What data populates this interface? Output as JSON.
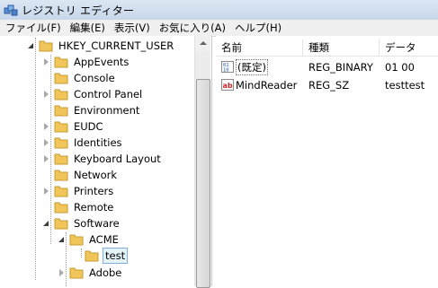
{
  "window": {
    "title": "レジストリ エディター"
  },
  "menu": [
    "ファイル(F)",
    "編集(E)",
    "表示(V)",
    "お気に入り(A)",
    "ヘルプ(H)"
  ],
  "tree": {
    "root": "HKEY_CURRENT_USER",
    "children": [
      "AppEvents",
      "Console",
      "Control Panel",
      "Environment",
      "EUDC",
      "Identities",
      "Keyboard Layout",
      "Network",
      "Printers",
      "Remote",
      "Software"
    ],
    "software_children": [
      "ACME",
      "Adobe"
    ],
    "acme_children": [
      "test"
    ],
    "selected": "test"
  },
  "list": {
    "columns": [
      "名前",
      "種類",
      "データ"
    ],
    "rows": [
      {
        "name": "(既定)",
        "type": "REG_BINARY",
        "data": "01 00",
        "icon": "binary-value-icon"
      },
      {
        "name": "MindReader",
        "type": "REG_SZ",
        "data": "testtest",
        "icon": "string-value-icon"
      }
    ]
  },
  "colors": {
    "folder": "#f0c65a",
    "selection": "#e5f3fb",
    "titlebar": "#c7d7ea"
  }
}
